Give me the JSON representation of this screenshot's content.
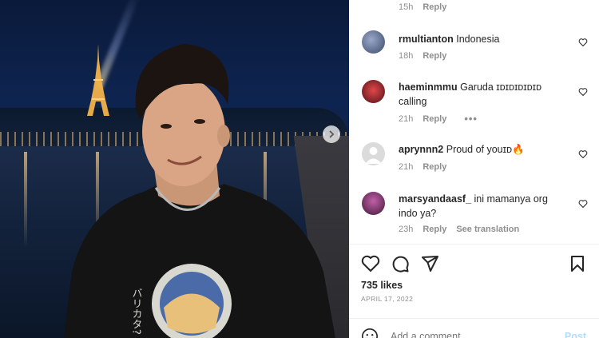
{
  "post": {
    "likes": "735 likes",
    "date": "APRIL 17, 2022",
    "add_comment_placeholder": "Add a comment...",
    "post_label": "Post"
  },
  "comments": [
    {
      "time": "15h",
      "reply": "Reply"
    },
    {
      "user": "rmultianton",
      "text": "Indonesia",
      "time": "18h",
      "reply": "Reply",
      "avatar_color": "#4a5a7a"
    },
    {
      "user": "haeminmmu",
      "text": "Garuda ɪᴅɪᴅɪᴅɪᴅɪᴅ calling",
      "time": "21h",
      "reply": "Reply",
      "more": "•••",
      "avatar_color": "#c0283a"
    },
    {
      "user": "aprynnn2",
      "text": "Proud of youɪᴅ🔥",
      "time": "21h",
      "reply": "Reply",
      "avatar_color": "#dbdbdb"
    },
    {
      "user": "marsyandaasf_",
      "text": "ini mamanya org indo ya?",
      "time": "23h",
      "reply": "Reply",
      "see_translation": "See translation",
      "avatar_color": "#7a2a6a"
    }
  ],
  "icons": {
    "like": "heart-icon",
    "comment": "comment-icon",
    "share": "share-icon",
    "save": "bookmark-icon",
    "emoji": "emoji-icon",
    "next": "chevron-right-icon"
  }
}
